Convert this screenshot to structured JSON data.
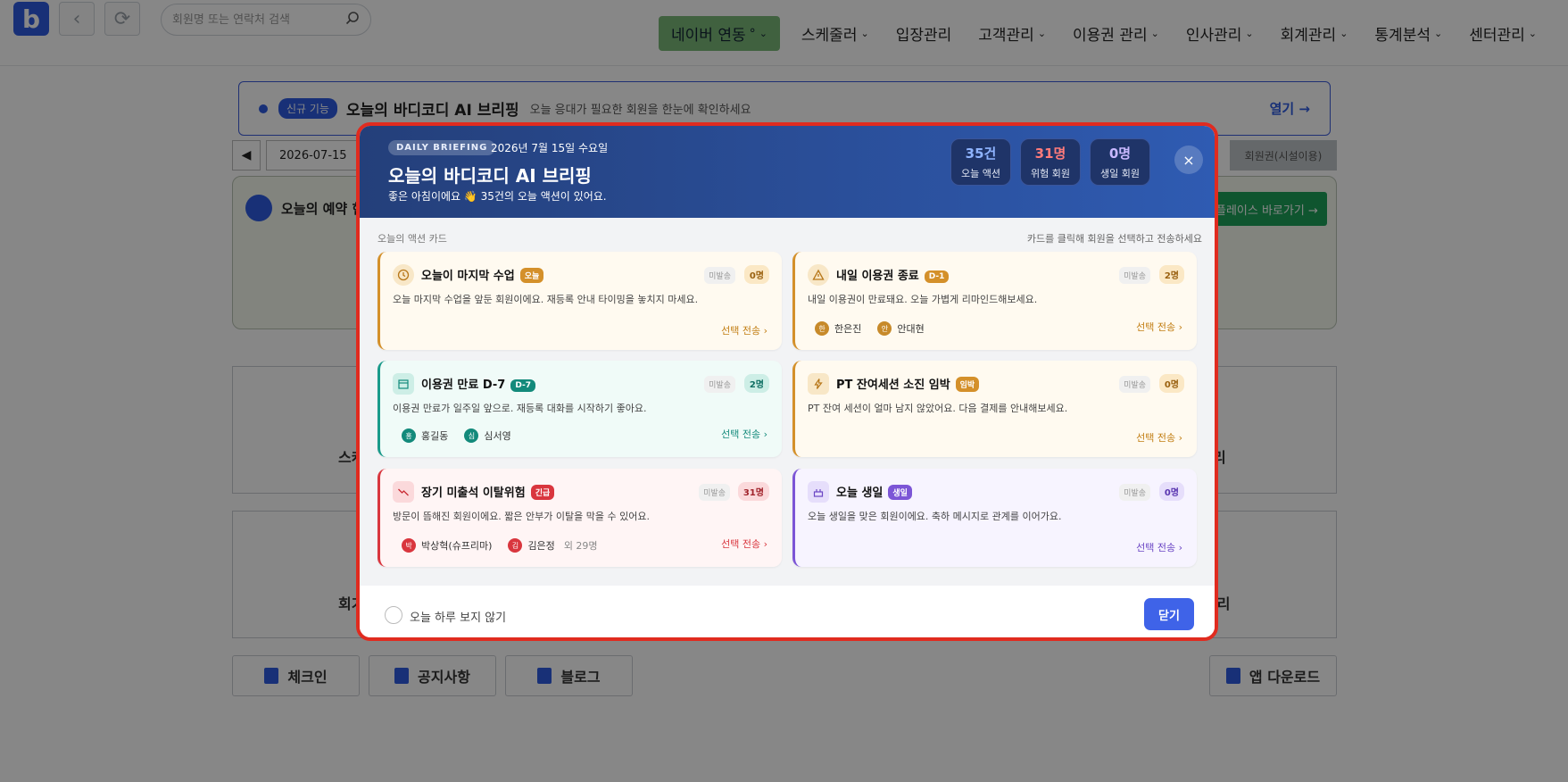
{
  "nav": {
    "search_placeholder": "회원명 또는 연락처 검색",
    "naver": "네이버 연동",
    "naver_mark": "°",
    "menu": [
      "스케줄러",
      "입장관리",
      "고객관리",
      "이용권 관리",
      "인사관리",
      "회계관리",
      "통계분석",
      "센터관리"
    ]
  },
  "background": {
    "banner_tag": "신규 기능",
    "banner_title": "오늘의 바디코디 AI 브리핑",
    "banner_sub": "오늘 응대가 필요한 회원을 한눈에 확인하세요",
    "banner_open": "열기 →",
    "date": "2026-07-15",
    "panel_title": "오늘의 예약 현",
    "gray_button": "회원권(시설이용)",
    "green_button": "플레이스 바로가기 →",
    "card_labels": [
      "스케",
      "리",
      "회기",
      "관리"
    ],
    "bottom_buttons": [
      "체크인",
      "공지사항",
      "블로그",
      "앱 다운로드"
    ]
  },
  "modal": {
    "tag": "DAILY BRIEFING",
    "date": "2026년 7월 15일 수요일",
    "title": "오늘의 바디코디 AI 브리핑",
    "subtitle": "좋은 아침이에요 👋 35건의 오늘 액션이 있어요.",
    "stats": [
      {
        "value": "35건",
        "label": "오늘 액션",
        "color": "#8fb4ff"
      },
      {
        "value": "31명",
        "label": "위험 회원",
        "color": "#ff7b7b"
      },
      {
        "value": "0명",
        "label": "생일 회원",
        "color": "#c8b8ff"
      }
    ],
    "close_icon": "×",
    "section_left": "오늘의 액션 카드",
    "section_right": "카드를 클릭해 회원을 선택하고 전송하세요",
    "unsent_label": "미발송",
    "send_label": "선택 전송 ›",
    "cards": [
      {
        "title": "오늘이 마지막 수업",
        "badge": "오늘",
        "count": "0명",
        "desc": "오늘 마지막 수업을 앞둔 회원이에요. 재등록 안내 타이밍을 놓치지 마세요.",
        "accent": "#d4902a",
        "bg": "#fffaf0",
        "icon": "clock-icon",
        "people": []
      },
      {
        "title": "내일 이용권 종료",
        "badge": "D-1",
        "count": "2명",
        "desc": "내일 이용권이 만료돼요. 오늘 가볍게 리마인드해보세요.",
        "accent": "#d4902a",
        "bg": "#fffaf0",
        "icon": "warning-icon",
        "people": [
          {
            "initial": "한",
            "name": "한은진"
          },
          {
            "initial": "안",
            "name": "안대현"
          }
        ]
      },
      {
        "title": "이용권 만료 D-7",
        "badge": "D-7",
        "count": "2명",
        "desc": "이용권 만료가 일주일 앞으로. 재등록 대화를 시작하기 좋아요.",
        "accent": "#1a9a8a",
        "bg": "#f0fbf8",
        "icon": "calendar-icon",
        "people": [
          {
            "initial": "홍",
            "name": "홍길동"
          },
          {
            "initial": "심",
            "name": "심서영"
          }
        ]
      },
      {
        "title": "PT 잔여세션 소진 임박",
        "badge": "임박",
        "count": "0명",
        "desc": "PT 잔여 세션이 얼마 남지 않았어요. 다음 결제를 안내해보세요.",
        "accent": "#d4902a",
        "bg": "#fffaf0",
        "icon": "lightning-icon",
        "people": []
      },
      {
        "title": "장기 미출석 이탈위험",
        "badge": "긴급",
        "count": "31명",
        "desc": "방문이 뜸해진 회원이에요. 짧은 안부가 이탈을 막을 수 있어요.",
        "accent": "#d9363e",
        "bg": "#fff5f5",
        "icon": "trend-down-icon",
        "people": [
          {
            "initial": "박",
            "name": "박상혁(슈프리마)"
          },
          {
            "initial": "김",
            "name": "김은정"
          }
        ],
        "more": "외 29명"
      },
      {
        "title": "오늘 생일",
        "badge": "생일",
        "count": "0명",
        "desc": "오늘 생일을 맞은 회원이에요. 축하 메시지로 관계를 이어가요.",
        "accent": "#7c55d6",
        "bg": "#f7f4ff",
        "icon": "cake-icon",
        "people": []
      }
    ],
    "dont_show": "오늘 하루 보지 않기",
    "close_button": "닫기"
  }
}
